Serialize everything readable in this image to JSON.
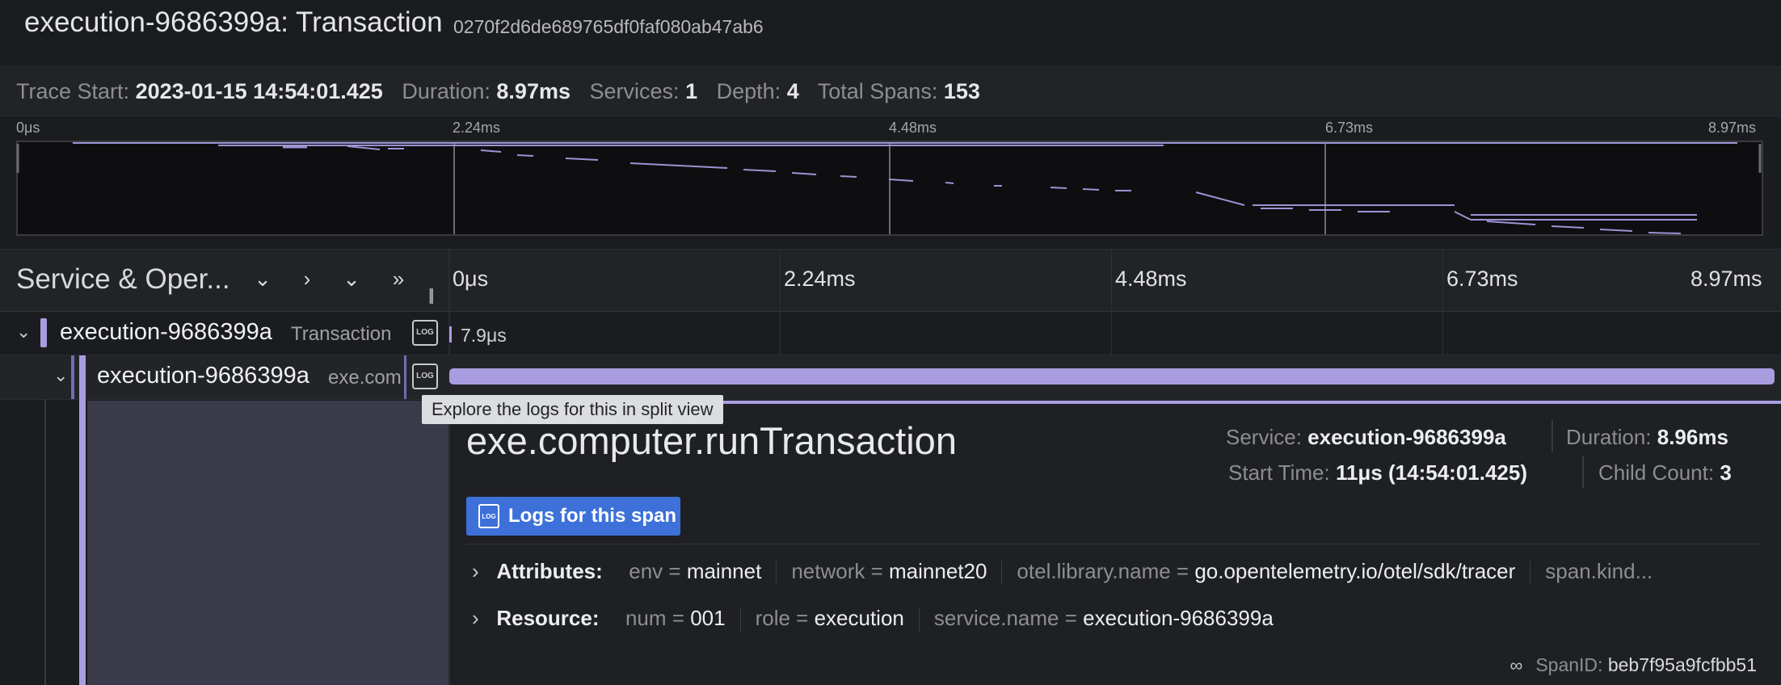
{
  "header": {
    "title": "execution-9686399a: Transaction",
    "trace_id": "0270f2d6de689765df0faf080ab47ab6"
  },
  "stats": {
    "trace_start_label": "Trace Start:",
    "trace_start_value": "2023-01-15 14:54:01.425",
    "duration_label": "Duration:",
    "duration_value": "8.97ms",
    "services_label": "Services:",
    "services_value": "1",
    "depth_label": "Depth:",
    "depth_value": "4",
    "total_spans_label": "Total Spans:",
    "total_spans_value": "153"
  },
  "minimap": {
    "ticks": [
      "0μs",
      "2.24ms",
      "4.48ms",
      "6.73ms",
      "8.97ms"
    ]
  },
  "timeline": {
    "column_title": "Service & Oper...",
    "ticks": [
      "0μs",
      "2.24ms",
      "4.48ms",
      "6.73ms",
      "8.97ms"
    ],
    "icons": [
      "chevron-down-icon",
      "chevron-right-icon",
      "chevrons-down-icon",
      "chevrons-right-icon"
    ]
  },
  "rows": [
    {
      "service": "execution-9686399a",
      "operation": "Transaction",
      "duration_label": "7.9μs"
    },
    {
      "service": "execution-9686399a",
      "operation": "exe.com"
    }
  ],
  "tooltip": "Explore the logs for this in split view",
  "detail": {
    "operation_title": "exe.computer.runTransaction",
    "service_label": "Service:",
    "service_value": "execution-9686399a",
    "duration_label": "Duration:",
    "duration_value": "8.96ms",
    "start_time_label": "Start Time:",
    "start_time_value": "11μs (14:54:01.425)",
    "child_count_label": "Child Count:",
    "child_count_value": "3",
    "logs_button": "Logs for this span",
    "attributes_label": "Attributes:",
    "attributes": [
      {
        "key": "env",
        "value": "mainnet"
      },
      {
        "key": "network",
        "value": "mainnet20"
      },
      {
        "key": "otel.library.name",
        "value": "go.opentelemetry.io/otel/sdk/tracer"
      }
    ],
    "attributes_overflow": "span.kind...",
    "resource_label": "Resource:",
    "resource": [
      {
        "key": "num",
        "value": "001"
      },
      {
        "key": "role",
        "value": "execution"
      },
      {
        "key": "service.name",
        "value": "execution-9686399a"
      }
    ],
    "span_id_label": "SpanID:",
    "span_id_value": "beb7f95a9fcfbb51"
  },
  "colors": {
    "span_bar": "#a99de0",
    "primary_button": "#3d71d9",
    "background": "#1b1c20"
  }
}
